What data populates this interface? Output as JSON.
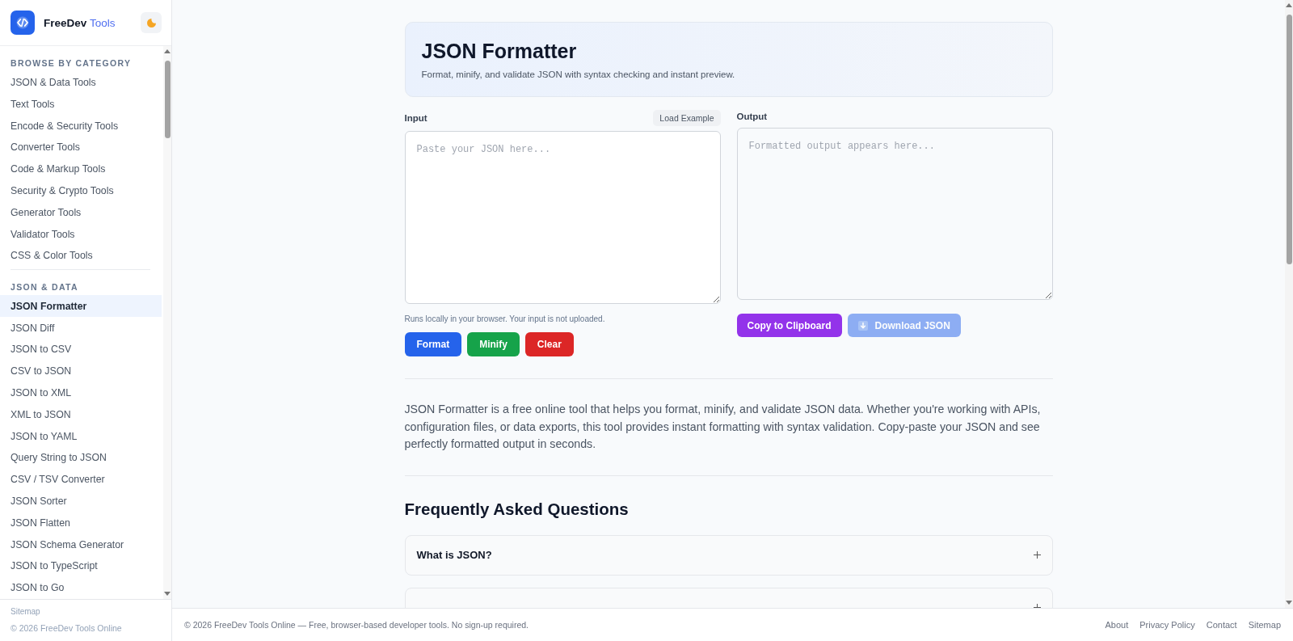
{
  "sidebar": {
    "brand": {
      "name": "FreeDev",
      "accent": "Tools"
    },
    "sections": [
      {
        "heading": "BROWSE BY CATEGORY",
        "items": [
          {
            "label": "JSON & Data Tools",
            "selected": false
          },
          {
            "label": "Text Tools",
            "selected": false
          },
          {
            "label": "Encode & Security Tools",
            "selected": false
          },
          {
            "label": "Converter Tools",
            "selected": false
          },
          {
            "label": "Code & Markup Tools",
            "selected": false
          },
          {
            "label": "Security & Crypto Tools",
            "selected": false
          },
          {
            "label": "Generator Tools",
            "selected": false
          },
          {
            "label": "Validator Tools",
            "selected": false
          },
          {
            "label": "CSS & Color Tools",
            "selected": false
          }
        ]
      },
      {
        "heading": "JSON & DATA",
        "items": [
          {
            "label": "JSON Formatter",
            "selected": true
          },
          {
            "label": "JSON Diff",
            "selected": false
          },
          {
            "label": "JSON to CSV",
            "selected": false
          },
          {
            "label": "CSV to JSON",
            "selected": false
          },
          {
            "label": "JSON to XML",
            "selected": false
          },
          {
            "label": "XML to JSON",
            "selected": false
          },
          {
            "label": "JSON to YAML",
            "selected": false
          },
          {
            "label": "Query String to JSON",
            "selected": false
          },
          {
            "label": "CSV / TSV Converter",
            "selected": false
          },
          {
            "label": "JSON Sorter",
            "selected": false
          },
          {
            "label": "JSON Flatten",
            "selected": false
          },
          {
            "label": "JSON Schema Generator",
            "selected": false
          },
          {
            "label": "JSON to TypeScript",
            "selected": false
          },
          {
            "label": "JSON to Go",
            "selected": false
          }
        ]
      }
    ],
    "footer_link": "Sitemap",
    "copyright": "© 2026 FreeDev Tools Online"
  },
  "header": {
    "title": "JSON Formatter",
    "subtitle": "Format, minify, and validate JSON with syntax checking and instant preview."
  },
  "input": {
    "label": "Input",
    "load_example": "Load Example",
    "placeholder": "Paste your JSON here...",
    "note": "Runs locally in your browser. Your input is not uploaded.",
    "actions": [
      {
        "label": "Format",
        "kind": "format",
        "disabled": false
      },
      {
        "label": "Minify",
        "kind": "minify",
        "disabled": false
      },
      {
        "label": "Clear",
        "kind": "clear",
        "disabled": false
      }
    ]
  },
  "output": {
    "label": "Output",
    "placeholder": "Formatted output appears here...",
    "actions": [
      {
        "label": "Copy to Clipboard",
        "kind": "copy",
        "disabled": false
      },
      {
        "label": "Download JSON",
        "kind": "download",
        "disabled": true
      }
    ]
  },
  "description": "JSON Formatter is a free online tool that helps you format, minify, and validate JSON data. Whether you're working with APIs, configuration files, or data exports, this tool provides instant formatting with syntax validation. Copy-paste your JSON and see perfectly formatted output in seconds.",
  "faq": {
    "heading": "Frequently Asked Questions",
    "items": [
      {
        "question": "What is JSON?",
        "expanded": false
      },
      {
        "expanded": false
      }
    ]
  },
  "footer": {
    "copyright": "© 2026 FreeDev Tools Online — Free, browser-based developer tools. No sign-up required.",
    "links": [
      "About",
      "Privacy Policy",
      "Contact",
      "Sitemap"
    ]
  }
}
